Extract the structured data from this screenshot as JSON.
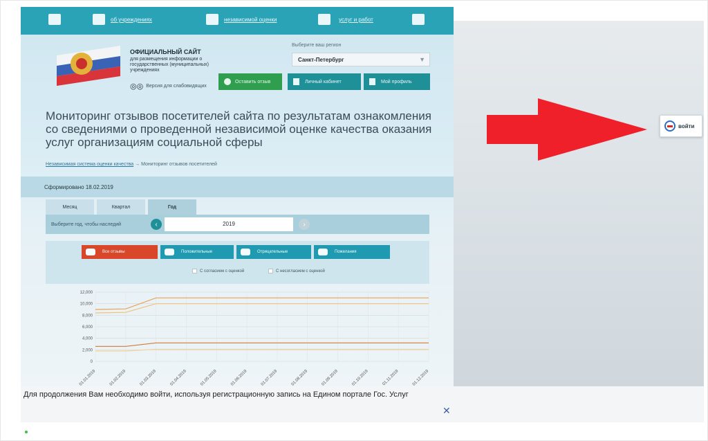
{
  "topbar": {
    "items": [
      "об учреждениях",
      "независимой оценки",
      "услуг и работ"
    ]
  },
  "header": {
    "title": "ОФИЦИАЛЬНЫЙ САЙТ",
    "subtitle": "для размещения информации о государственных (муниципальных) учреждениях",
    "low_vision": "Версия для слабовидящих",
    "region_label": "Выберите ваш регион",
    "region_value": "Санкт-Петербург",
    "buttons": {
      "feedback": "Оставить отзыв",
      "cabinet": "Личный кабинет",
      "profile": "Мой профиль"
    },
    "colors": {
      "topbar": "#2aa3b7",
      "green": "#2f9f4f",
      "teal": "#1f8f98"
    }
  },
  "main": {
    "title": "Мониторинг отзывов посетителей сайта по результатам ознакомления со сведениями о проведенной независимой оценке качества оказания услуг организациям социальной сферы",
    "breadcrumb": {
      "link": "Независимая система оценки качества",
      "separator": "→",
      "current": "Мониторинг отзывов посетителей"
    },
    "formed": "Сформировано 18.02.2019",
    "tabs": [
      {
        "label": "Месяц"
      },
      {
        "label": "Квартал"
      },
      {
        "label": "Год"
      }
    ],
    "year_label": "Выберите год, чтобы наследий",
    "year_value": "2019",
    "filters": {
      "all": "Все отзывы",
      "positive": "Положительные",
      "negative": "Отрицательные",
      "suggestions": "Пожелания"
    },
    "checkboxes": [
      "С согласием с оценкой",
      "С несогласием с оценкой"
    ]
  },
  "chart_data": {
    "type": "line",
    "x": [
      "01.01.2019",
      "01.02.2019",
      "01.03.2019",
      "01.04.2019",
      "01.05.2019",
      "01.06.2019",
      "01.07.2019",
      "01.08.2019",
      "01.09.2019",
      "01.10.2019",
      "01.11.2019",
      "01.12.2019"
    ],
    "yticks": [
      "12,000",
      "10,000",
      "8,000",
      "6,000",
      "4,000",
      "2,000",
      "0"
    ],
    "ylim": [
      0,
      12000
    ],
    "grid": true,
    "series": [
      {
        "values": [
          9000,
          9100,
          11000,
          11000,
          11000,
          11000,
          11000,
          11000,
          11000,
          11000,
          11000,
          11000
        ],
        "color": "#e8a35a"
      },
      {
        "values": [
          8400,
          8500,
          10000,
          10000,
          10000,
          10000,
          10000,
          10000,
          10000,
          10000,
          10000,
          10000
        ],
        "color": "#f0c27a"
      },
      {
        "values": [
          2600,
          2600,
          3200,
          3200,
          3200,
          3200,
          3200,
          3200,
          3200,
          3200,
          3200,
          3200
        ],
        "color": "#d47a3a"
      },
      {
        "values": [
          1800,
          1800,
          2100,
          2100,
          2100,
          2100,
          2100,
          2100,
          2100,
          2100,
          2100,
          2100
        ],
        "color": "#f2d49a"
      }
    ]
  },
  "login": {
    "label": "войти"
  },
  "notice": {
    "text": "Для продолжения Вам необходимо войти, используя регистрационную запись на Едином портале Гос. Услуг",
    "close": "✕"
  }
}
